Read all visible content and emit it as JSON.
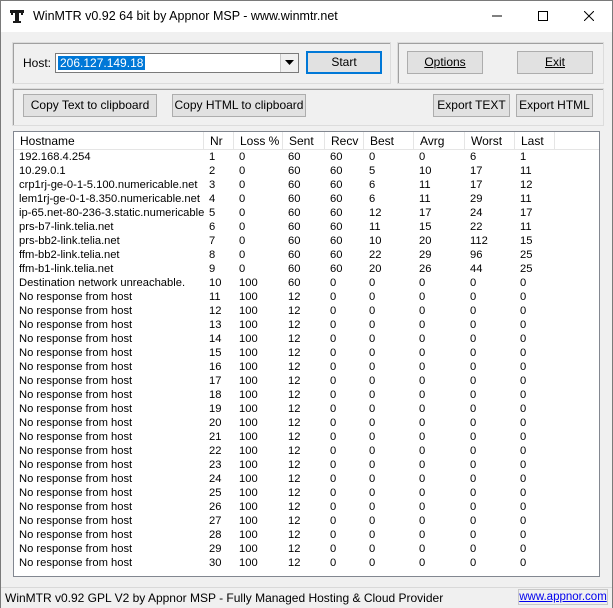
{
  "window": {
    "title": "WinMTR v0.92 64 bit by Appnor MSP - www.winmtr.net",
    "icon": "winmtr-app-icon",
    "controls": [
      "minimize-icon",
      "maximize-icon",
      "close-icon"
    ]
  },
  "host": {
    "label": "Host:",
    "value": "206.127.149.18"
  },
  "buttons": {
    "start": "Start",
    "options": "Options",
    "exit": "Exit",
    "copy_text": "Copy Text to clipboard",
    "copy_html": "Copy HTML to clipboard",
    "export_text": "Export TEXT",
    "export_html": "Export HTML"
  },
  "table": {
    "columns": [
      "Hostname",
      "Nr",
      "Loss %",
      "Sent",
      "Recv",
      "Best",
      "Avrg",
      "Worst",
      "Last"
    ],
    "rows": [
      [
        "192.168.4.254",
        "1",
        "0",
        "60",
        "60",
        "0",
        "0",
        "6",
        "1"
      ],
      [
        "10.29.0.1",
        "2",
        "0",
        "60",
        "60",
        "5",
        "10",
        "17",
        "11"
      ],
      [
        "crp1rj-ge-0-1-5.100.numericable.net",
        "3",
        "0",
        "60",
        "60",
        "6",
        "11",
        "17",
        "12"
      ],
      [
        "lem1rj-ge-0-1-8.350.numericable.net",
        "4",
        "0",
        "60",
        "60",
        "6",
        "11",
        "29",
        "11"
      ],
      [
        "ip-65.net-80-236-3.static.numericable.fr",
        "5",
        "0",
        "60",
        "60",
        "12",
        "17",
        "24",
        "17"
      ],
      [
        "prs-b7-link.telia.net",
        "6",
        "0",
        "60",
        "60",
        "11",
        "15",
        "22",
        "11"
      ],
      [
        "prs-bb2-link.telia.net",
        "7",
        "0",
        "60",
        "60",
        "10",
        "20",
        "112",
        "15"
      ],
      [
        "ffm-bb2-link.telia.net",
        "8",
        "0",
        "60",
        "60",
        "22",
        "29",
        "96",
        "25"
      ],
      [
        "ffm-b1-link.telia.net",
        "9",
        "0",
        "60",
        "60",
        "20",
        "26",
        "44",
        "25"
      ],
      [
        "Destination network unreachable.",
        "10",
        "100",
        "60",
        "0",
        "0",
        "0",
        "0",
        "0"
      ],
      [
        "No response from host",
        "11",
        "100",
        "12",
        "0",
        "0",
        "0",
        "0",
        "0"
      ],
      [
        "No response from host",
        "12",
        "100",
        "12",
        "0",
        "0",
        "0",
        "0",
        "0"
      ],
      [
        "No response from host",
        "13",
        "100",
        "12",
        "0",
        "0",
        "0",
        "0",
        "0"
      ],
      [
        "No response from host",
        "14",
        "100",
        "12",
        "0",
        "0",
        "0",
        "0",
        "0"
      ],
      [
        "No response from host",
        "15",
        "100",
        "12",
        "0",
        "0",
        "0",
        "0",
        "0"
      ],
      [
        "No response from host",
        "16",
        "100",
        "12",
        "0",
        "0",
        "0",
        "0",
        "0"
      ],
      [
        "No response from host",
        "17",
        "100",
        "12",
        "0",
        "0",
        "0",
        "0",
        "0"
      ],
      [
        "No response from host",
        "18",
        "100",
        "12",
        "0",
        "0",
        "0",
        "0",
        "0"
      ],
      [
        "No response from host",
        "19",
        "100",
        "12",
        "0",
        "0",
        "0",
        "0",
        "0"
      ],
      [
        "No response from host",
        "20",
        "100",
        "12",
        "0",
        "0",
        "0",
        "0",
        "0"
      ],
      [
        "No response from host",
        "21",
        "100",
        "12",
        "0",
        "0",
        "0",
        "0",
        "0"
      ],
      [
        "No response from host",
        "22",
        "100",
        "12",
        "0",
        "0",
        "0",
        "0",
        "0"
      ],
      [
        "No response from host",
        "23",
        "100",
        "12",
        "0",
        "0",
        "0",
        "0",
        "0"
      ],
      [
        "No response from host",
        "24",
        "100",
        "12",
        "0",
        "0",
        "0",
        "0",
        "0"
      ],
      [
        "No response from host",
        "25",
        "100",
        "12",
        "0",
        "0",
        "0",
        "0",
        "0"
      ],
      [
        "No response from host",
        "26",
        "100",
        "12",
        "0",
        "0",
        "0",
        "0",
        "0"
      ],
      [
        "No response from host",
        "27",
        "100",
        "12",
        "0",
        "0",
        "0",
        "0",
        "0"
      ],
      [
        "No response from host",
        "28",
        "100",
        "12",
        "0",
        "0",
        "0",
        "0",
        "0"
      ],
      [
        "No response from host",
        "29",
        "100",
        "12",
        "0",
        "0",
        "0",
        "0",
        "0"
      ],
      [
        "No response from host",
        "30",
        "100",
        "12",
        "0",
        "0",
        "0",
        "0",
        "0"
      ]
    ]
  },
  "status": {
    "text": "WinMTR v0.92 GPL V2 by Appnor MSP - Fully Managed Hosting & Cloud Provider",
    "link": "www.appnor.com"
  },
  "colors": {
    "selection": "#0078d7",
    "link": "#0000ee",
    "default_button_border": "#0078d7"
  }
}
